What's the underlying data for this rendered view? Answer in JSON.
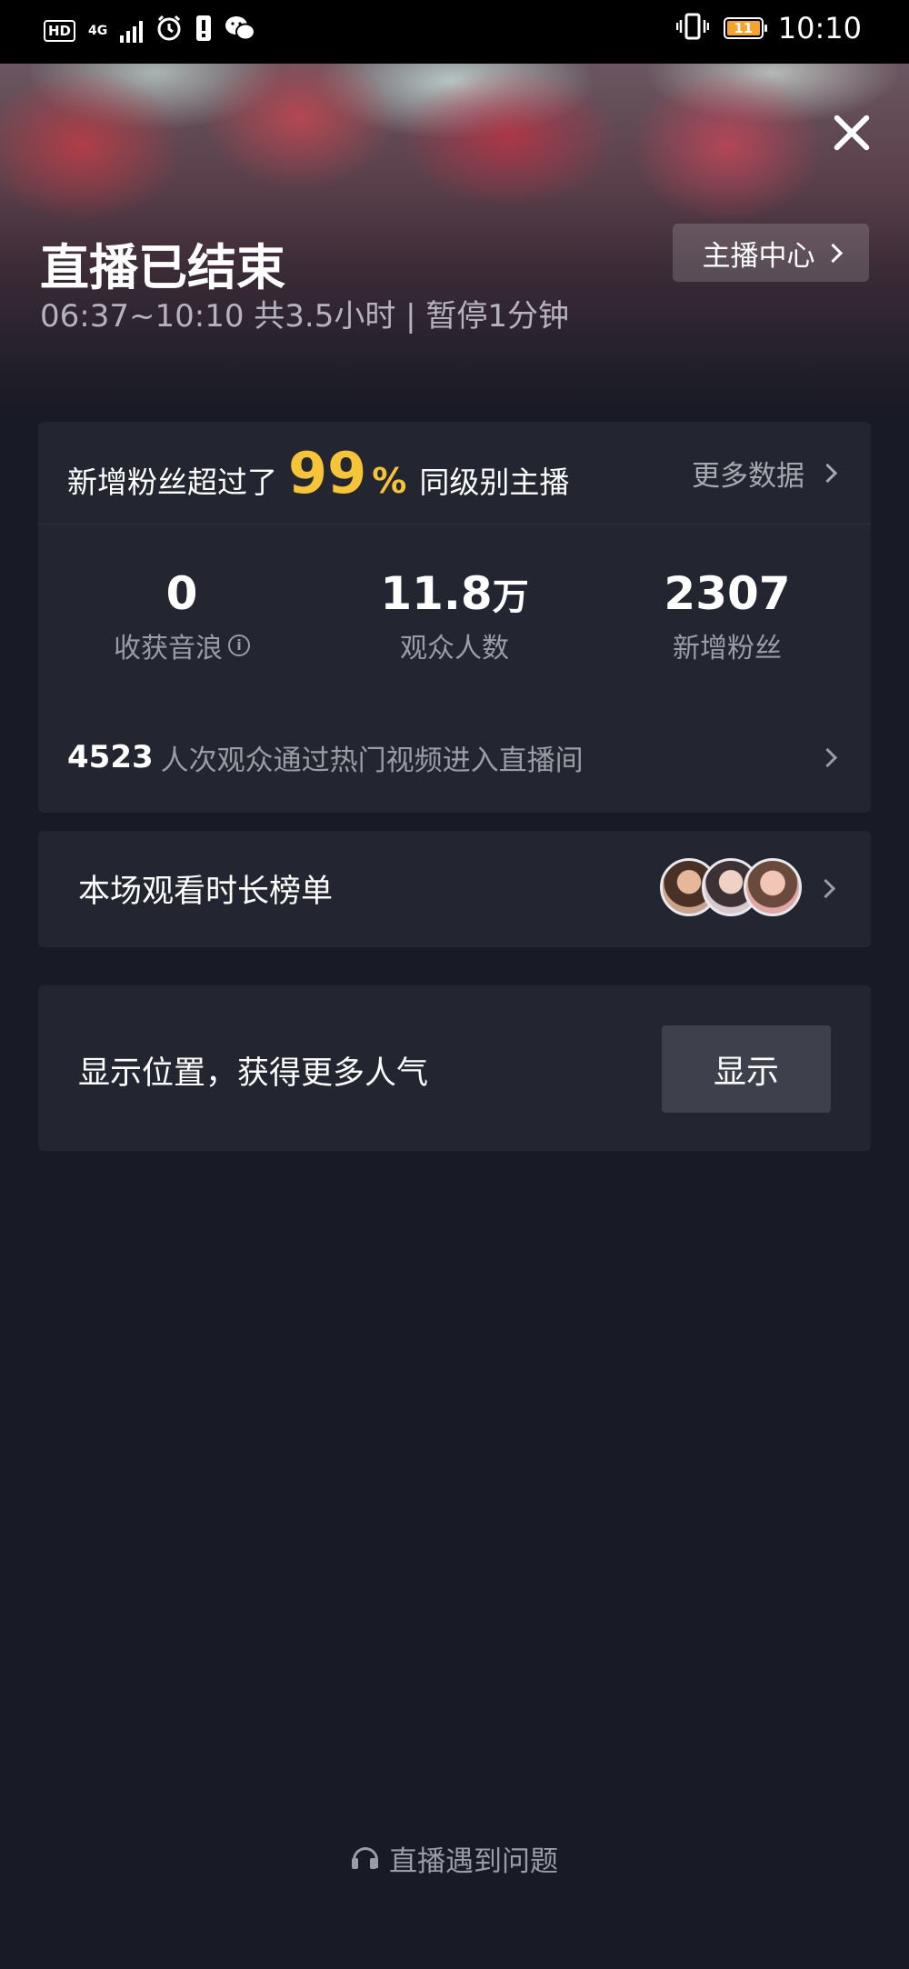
{
  "status_bar": {
    "hd": "HD",
    "network": "4G",
    "alarm_icon": "alarm-icon",
    "notification_icon": "alert-icon",
    "wechat_icon": "wechat-icon",
    "vibrate_icon": "vibrate-icon",
    "battery_level": "11",
    "time": "10:10"
  },
  "header": {
    "title": "直播已结束",
    "subtitle": "06:37~10:10 共3.5小时 | 暂停1分钟",
    "center_button": "主播中心",
    "close_icon": "close-icon"
  },
  "stats_card": {
    "headline_prefix": "新增粉丝超过了",
    "headline_percent": "99",
    "headline_percent_sign": "%",
    "headline_suffix": "同级别主播",
    "more_data": "更多数据",
    "metrics": [
      {
        "value": "0",
        "unit": "",
        "label": "收获音浪",
        "has_info": true
      },
      {
        "value": "11.8",
        "unit": "万",
        "label": "观众人数",
        "has_info": false
      },
      {
        "value": "2307",
        "unit": "",
        "label": "新增粉丝",
        "has_info": false
      }
    ],
    "hot_count": "4523",
    "hot_text": "人次观众通过热门视频进入直播间"
  },
  "rank_card": {
    "label": "本场观看时长榜单"
  },
  "location_card": {
    "label": "显示位置，获得更多人气",
    "button": "显示"
  },
  "footer": {
    "help": "直播遇到问题",
    "help_icon": "headset-icon"
  },
  "colors": {
    "accent": "#f5c438",
    "background": "#181a25",
    "card": "#232630"
  }
}
